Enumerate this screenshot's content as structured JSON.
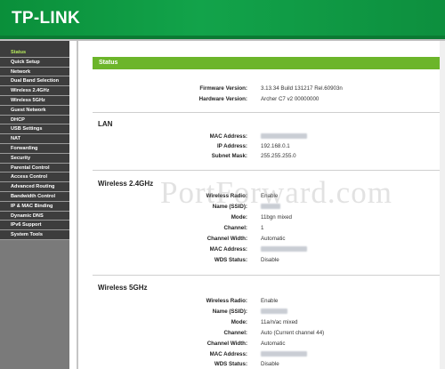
{
  "brand": {
    "logo": "TP-LINK"
  },
  "sidebar": {
    "items": [
      {
        "label": "Status",
        "active": true
      },
      {
        "label": "Quick Setup"
      },
      {
        "label": "Network"
      },
      {
        "label": "Dual Band Selection"
      },
      {
        "label": "Wireless 2.4GHz"
      },
      {
        "label": "Wireless 5GHz"
      },
      {
        "label": "Guest Network"
      },
      {
        "label": "DHCP"
      },
      {
        "label": "USB Settings"
      },
      {
        "label": "NAT"
      },
      {
        "label": "Forwarding"
      },
      {
        "label": "Security"
      },
      {
        "label": "Parental Control"
      },
      {
        "label": "Access Control"
      },
      {
        "label": "Advanced Routing"
      },
      {
        "label": "Bandwidth Control"
      },
      {
        "label": "IP & MAC Binding"
      },
      {
        "label": "Dynamic DNS"
      },
      {
        "label": "IPv6 Support"
      },
      {
        "label": "System Tools"
      }
    ]
  },
  "main": {
    "status_title": "Status",
    "firmware_label": "Firmware Version:",
    "firmware_value": "3.13.34 Build 131217 Rel.60903n",
    "hardware_label": "Hardware Version:",
    "hardware_value": "Archer C7 v2 00000000",
    "lan": {
      "title": "LAN",
      "mac_label": "MAC Address:",
      "ip_label": "IP Address:",
      "ip_value": "192.168.0.1",
      "subnet_label": "Subnet Mask:",
      "subnet_value": "255.255.255.0"
    },
    "wireless24": {
      "title": "Wireless 2.4GHz",
      "radio_label": "Wireless Radio:",
      "radio_value": "Enable",
      "ssid_label": "Name (SSID):",
      "mode_label": "Mode:",
      "mode_value": "11bgn mixed",
      "channel_label": "Channel:",
      "channel_value": "1",
      "width_label": "Channel Width:",
      "width_value": "Automatic",
      "mac_label": "MAC Address:",
      "wds_label": "WDS Status:",
      "wds_value": "Disable"
    },
    "wireless5": {
      "title": "Wireless 5GHz",
      "radio_label": "Wireless Radio:",
      "radio_value": "Enable",
      "ssid_label": "Name (SSID):",
      "mode_label": "Mode:",
      "mode_value": "11a/n/ac mixed",
      "channel_label": "Channel:",
      "channel_value": "Auto (Current channel 44)",
      "width_label": "Channel Width:",
      "width_value": "Automatic",
      "mac_label": "MAC Address:",
      "wds_label": "WDS Status:",
      "wds_value": "Disable"
    }
  },
  "watermark": "PortForward.com",
  "colors": {
    "header_green": "#12a34a",
    "status_bar_green": "#6cb52a",
    "sidebar_bg": "#3d3d3d",
    "active_item": "#b6ea5c"
  }
}
